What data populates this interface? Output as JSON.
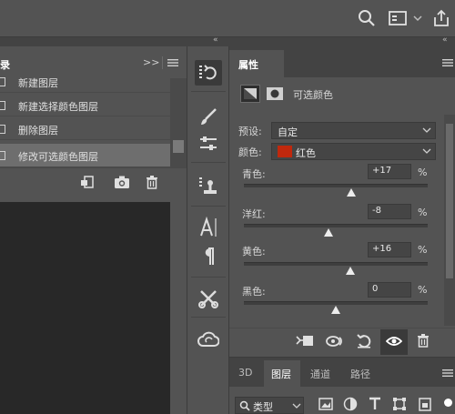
{
  "colors": {
    "panel_bg": "#535353",
    "panel_dark": "#434343",
    "canvas_bg": "#282828",
    "red_swatch": "#c0280d"
  },
  "top_bar": {
    "icons": [
      "search-icon",
      "workspace-icon",
      "chevron-down-icon",
      "share-icon"
    ]
  },
  "history": {
    "tab_label": "录",
    "collapse_label": ">>",
    "items": [
      {
        "label": "新建图层"
      },
      {
        "label": "新建选择颜色图层"
      },
      {
        "label": "删除图层"
      },
      {
        "label": "修改可选颜色图层",
        "selected": true
      }
    ],
    "footer_icons": [
      "new-document-from-state-icon",
      "snapshot-camera-icon",
      "trash-icon"
    ]
  },
  "toolstrip": {
    "collapse_label": "«",
    "tools": [
      "history-tool-icon",
      "brush-icon",
      "adjustments-icon",
      "character-stamp-icon",
      "character-icon",
      "paragraph-icon",
      "tools-icon",
      "creative-cloud-icon"
    ]
  },
  "properties": {
    "collapse_label": "«",
    "tab_label": "属性",
    "adjustment_title": "可选颜色",
    "preset_label": "预设:",
    "preset_value": "自定",
    "color_label": "颜色:",
    "color_value": "红色",
    "sliders": [
      {
        "label": "青色:",
        "value": "+17",
        "unit": "%",
        "percent": 17
      },
      {
        "label": "洋红:",
        "value": "-8",
        "unit": "%",
        "percent": -8
      },
      {
        "label": "黄色:",
        "value": "+16",
        "unit": "%",
        "percent": 16
      },
      {
        "label": "黑色:",
        "value": "0",
        "unit": "%",
        "percent": 0
      }
    ],
    "footer_icons": [
      "clip-to-layer-icon",
      "view-previous-state-icon",
      "reset-icon",
      "visibility-eye-icon",
      "delete-adjustment-icon"
    ]
  },
  "layers": {
    "tabs": [
      {
        "label": "3D"
      },
      {
        "label": "图层",
        "active": true
      },
      {
        "label": "通道"
      },
      {
        "label": "路径"
      }
    ],
    "kind_label": "类型"
  }
}
